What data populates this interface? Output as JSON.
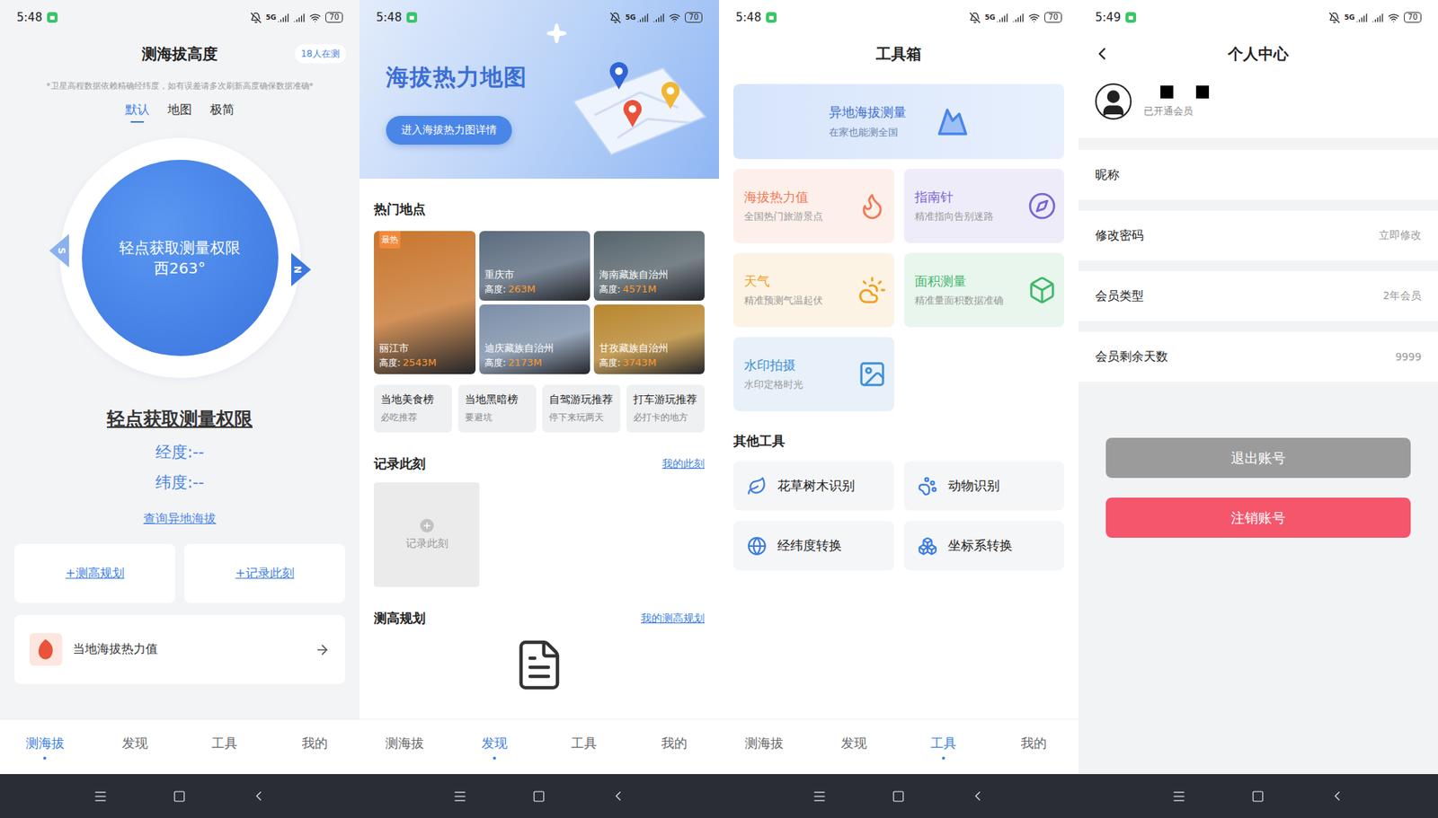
{
  "altitude": {
    "status_bar": {
      "time": "5:48",
      "network": "5G",
      "battery": "70"
    },
    "title": "测海拔高度",
    "badge": "18人在测",
    "notice": "*卫星高程数据依赖精确经纬度，如有误差请多次刷新高度确保数据准确*",
    "modes": [
      {
        "label": "默认",
        "selected": true
      },
      {
        "label": "地图",
        "selected": false
      },
      {
        "label": "极简",
        "selected": false
      }
    ],
    "compass": {
      "prompt": "轻点获取测量权限",
      "heading": "西263°",
      "south": "S",
      "north": "N"
    },
    "permission_link": "轻点获取测量权限",
    "longitude": "经度:--",
    "latitude": "纬度:--",
    "remote_link": "查询异地海拔",
    "actions": [
      "+测高规划",
      "+记录此刻"
    ],
    "heat_card": "当地海拔热力值",
    "nav": [
      {
        "label": "测海拔",
        "selected": true
      },
      {
        "label": "发现",
        "selected": false
      },
      {
        "label": "工具",
        "selected": false
      },
      {
        "label": "我的",
        "selected": false
      }
    ]
  },
  "discover": {
    "status_bar": {
      "time": "5:48",
      "network": "5G",
      "battery": "70"
    },
    "banner": {
      "title": "海拔热力地图",
      "button": "进入海拔热力图详情"
    },
    "hot_title": "热门地点",
    "places": [
      {
        "name": "丽江市",
        "height_label": "高度:",
        "height": "2543M",
        "badge": "最热",
        "color": "#c8762e"
      },
      {
        "name": "重庆市",
        "height_label": "高度:",
        "height": "263M",
        "color": "#5b6b7e"
      },
      {
        "name": "海南藏族自治州",
        "height_label": "高度:",
        "height": "4571M",
        "color": "#56646b"
      },
      {
        "name": "迪庆藏族自治州",
        "height_label": "高度:",
        "height": "2173M",
        "color": "#7c8fa8"
      },
      {
        "name": "甘孜藏族自治州",
        "height_label": "高度:",
        "height": "3743M",
        "color": "#b8862e"
      }
    ],
    "chips": [
      {
        "title": "当地美食榜",
        "subtitle": "必吃推荐"
      },
      {
        "title": "当地黑暗榜",
        "subtitle": "要避坑"
      },
      {
        "title": "自驾游玩推荐",
        "subtitle": "停下来玩两天"
      },
      {
        "title": "打车游玩推荐",
        "subtitle": "必打卡的地方"
      }
    ],
    "moments": {
      "title": "记录此刻",
      "link": "我的此刻",
      "add": "记录此刻"
    },
    "plans": {
      "title": "测高规划",
      "link": "我的测高规划"
    },
    "nav": [
      {
        "label": "测海拔",
        "selected": false
      },
      {
        "label": "发现",
        "selected": true
      },
      {
        "label": "工具",
        "selected": false
      },
      {
        "label": "我的",
        "selected": false
      }
    ]
  },
  "toolbox": {
    "status_bar": {
      "time": "5:48",
      "network": "5G",
      "battery": "70"
    },
    "title": "工具箱",
    "featured": {
      "title": "异地海拔测量",
      "subtitle": "在家也能测全国"
    },
    "tools": [
      {
        "title": "海拔热力值",
        "subtitle": "全国热门旅游景点",
        "kind": "flame",
        "color": "#f07a55"
      },
      {
        "title": "指南针",
        "subtitle": "精准指向告别迷路",
        "kind": "compass",
        "color": "#7a66d8"
      },
      {
        "title": "天气",
        "subtitle": "精准预测气温起伏",
        "kind": "weather",
        "color": "#f0a020"
      },
      {
        "title": "面积测量",
        "subtitle": "精准量面积数据准确",
        "kind": "area",
        "color": "#3fb86b"
      },
      {
        "title": "水印拍摄",
        "subtitle": "水印定格时光",
        "kind": "camera",
        "color": "#3f8fd8"
      }
    ],
    "other_title": "其他工具",
    "other_tools": [
      {
        "label": "花草树木识别",
        "kind": "plant"
      },
      {
        "label": "动物识别",
        "kind": "animal"
      },
      {
        "label": "经纬度转换",
        "kind": "globe"
      },
      {
        "label": "坐标系转换",
        "kind": "axis"
      }
    ],
    "nav": [
      {
        "label": "测海拔",
        "selected": false
      },
      {
        "label": "发现",
        "selected": false
      },
      {
        "label": "工具",
        "selected": true
      },
      {
        "label": "我的",
        "selected": false
      }
    ]
  },
  "profile": {
    "status_bar": {
      "time": "5:49",
      "network": "5G",
      "battery": "70"
    },
    "title": "个人中心",
    "member_status": "已开通会员",
    "rows": [
      {
        "label": "昵称"
      },
      {
        "label": "修改密码",
        "value": "立即修改"
      },
      {
        "label": "会员类型",
        "value": "2年会员"
      },
      {
        "label": "会员剩余天数",
        "value": "9999"
      }
    ],
    "buttons": [
      {
        "label": "退出账号",
        "kind": "secondary"
      },
      {
        "label": "注销账号",
        "kind": "danger"
      }
    ]
  }
}
